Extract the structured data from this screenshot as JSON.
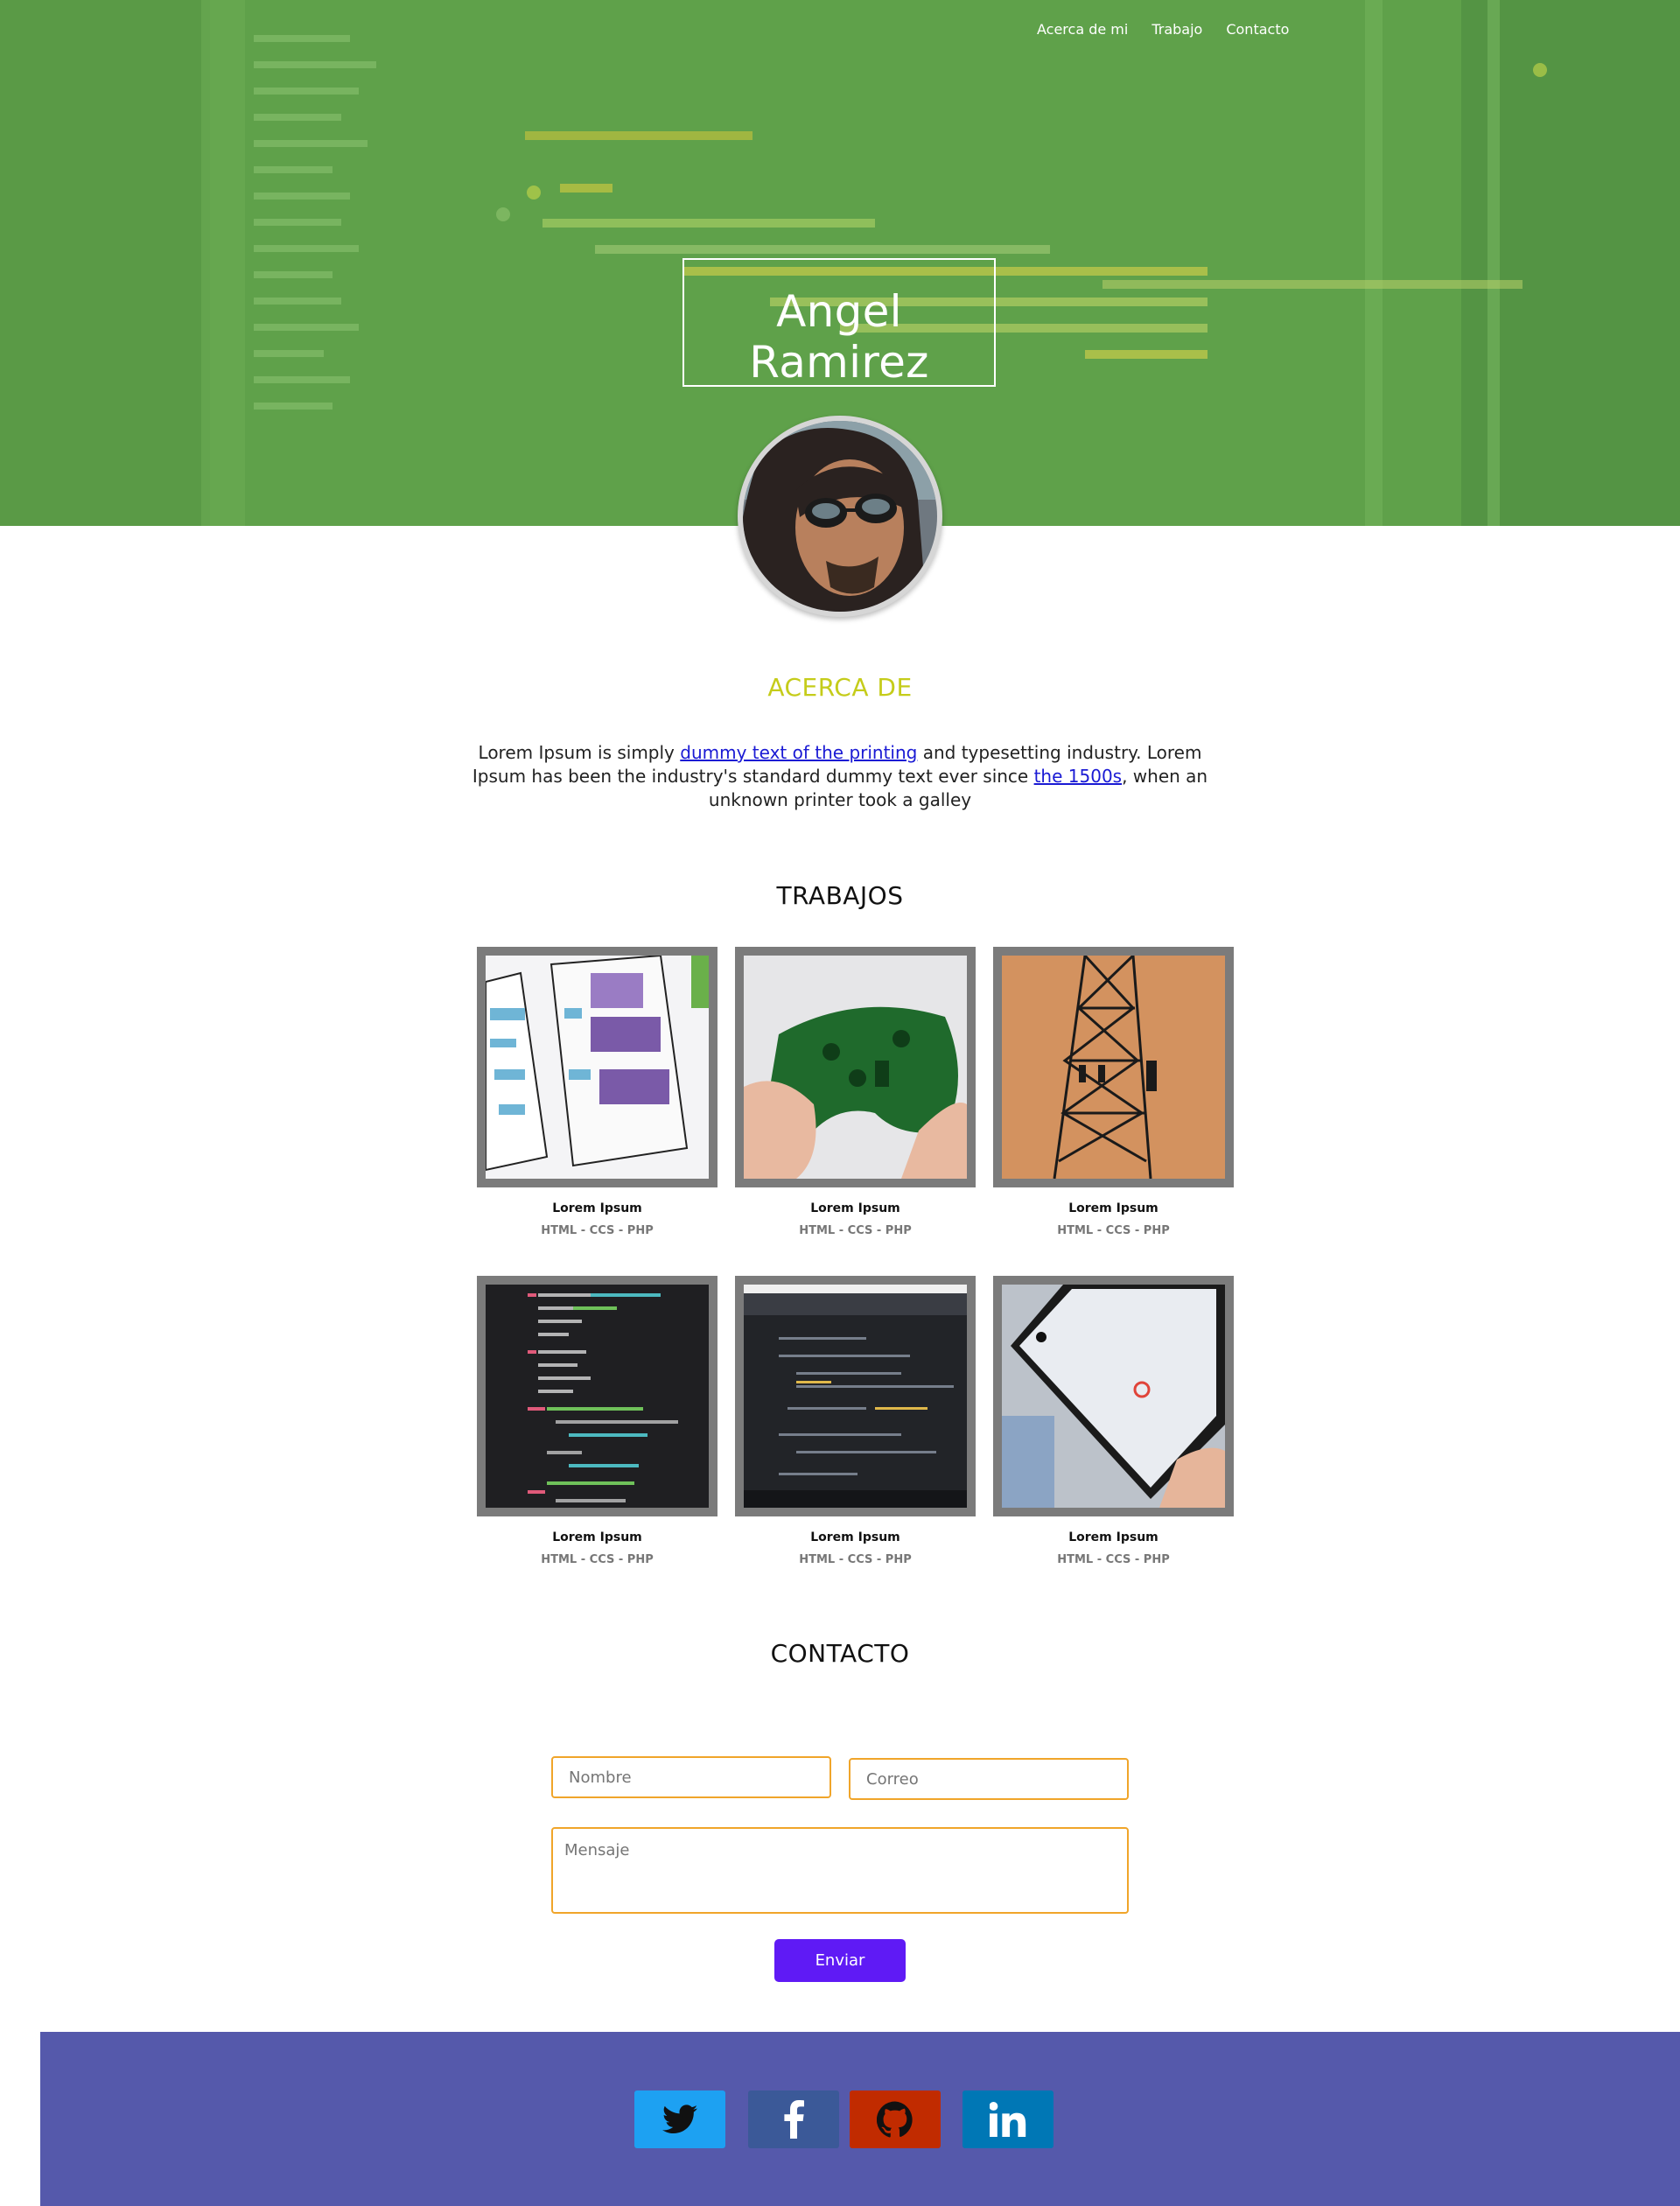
{
  "nav": {
    "items": [
      "Acerca de mi",
      "Trabajo",
      "Contacto"
    ]
  },
  "hero": {
    "name": "Angel Ramirez"
  },
  "about": {
    "title": "ACERCA DE",
    "text_1": "Lorem Ipsum is simply ",
    "link_1": "dummy text of the printing",
    "text_2": " and typesetting industry. Lorem Ipsum has been the industry's standard dummy text ever since ",
    "link_2": "the 1500s",
    "text_3": ", when an unknown printer took a galley"
  },
  "works": {
    "title": "TRABAJOS",
    "items": [
      {
        "title": "Lorem Ipsum",
        "tech": "HTML - CCS - PHP"
      },
      {
        "title": "Lorem Ipsum",
        "tech": "HTML - CCS - PHP"
      },
      {
        "title": "Lorem Ipsum",
        "tech": "HTML - CCS - PHP"
      },
      {
        "title": "Lorem Ipsum",
        "tech": "HTML - CCS - PHP"
      },
      {
        "title": "Lorem Ipsum",
        "tech": "HTML - CCS - PHP"
      },
      {
        "title": "Lorem Ipsum",
        "tech": "HTML - CCS - PHP"
      }
    ]
  },
  "contact": {
    "title": "CONTACTO",
    "name_placeholder": "Nombre",
    "email_placeholder": "Correo",
    "message_placeholder": "Mensaje",
    "submit_label": "Enviar"
  },
  "footer": {
    "social": [
      {
        "name": "twitter",
        "color": "#1da1f2"
      },
      {
        "name": "facebook",
        "color": "#3b5998"
      },
      {
        "name": "github",
        "color": "#c12b00"
      },
      {
        "name": "linkedin",
        "color": "#0077b5"
      }
    ]
  },
  "colors": {
    "hero_bg": "#5fa14a",
    "about_title": "#c5cc1a",
    "input_border": "#f0a52a",
    "submit_bg": "#5f1af5",
    "footer_bg": "#5559ab",
    "thumb_frame": "#7b7b7b"
  }
}
